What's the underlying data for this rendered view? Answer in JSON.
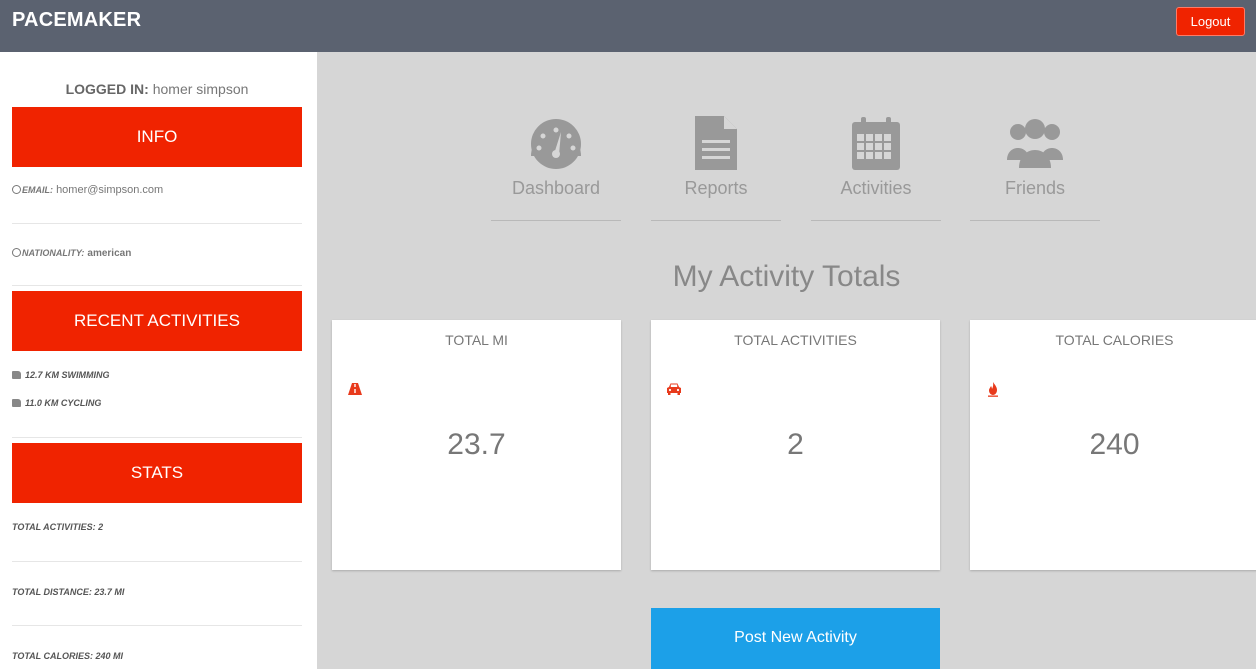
{
  "header": {
    "brand": "PACEMAKER",
    "logout_label": "Logout"
  },
  "sidebar": {
    "logged_in_label": "LOGGED IN:",
    "logged_in_user": "homer simpson",
    "info_label": "INFO",
    "email_key": "EMAIL:",
    "email_value": "homer@simpson.com",
    "nationality_key": "NATIONALITY:",
    "nationality_value": "american",
    "recent_label": "RECENT ACTIVITIES",
    "recent_activities": [
      "12.7 KM SWIMMING",
      "11.0 KM CYCLING"
    ],
    "stats_label": "STATS",
    "stats": [
      "TOTAL ACTIVITIES: 2",
      "TOTAL DISTANCE: 23.7 MI",
      "TOTAL CALORIES: 240 MI"
    ]
  },
  "nav": [
    {
      "label": "Dashboard",
      "icon": "gauge-icon"
    },
    {
      "label": "Reports",
      "icon": "document-icon"
    },
    {
      "label": "Activities",
      "icon": "calendar-icon"
    },
    {
      "label": "Friends",
      "icon": "users-icon"
    }
  ],
  "main": {
    "heading": "My Activity Totals",
    "cards": [
      {
        "title": "TOTAL MI",
        "icon": "road-icon",
        "value": "23.7"
      },
      {
        "title": "TOTAL ACTIVITIES",
        "icon": "car-icon",
        "value": "2"
      },
      {
        "title": "TOTAL CALORIES",
        "icon": "fire-icon",
        "value": "240"
      }
    ],
    "post_label": "Post New Activity"
  },
  "colors": {
    "accent_red": "#f02300",
    "accent_blue": "#1ca0e8",
    "topbar": "#5b6270"
  }
}
